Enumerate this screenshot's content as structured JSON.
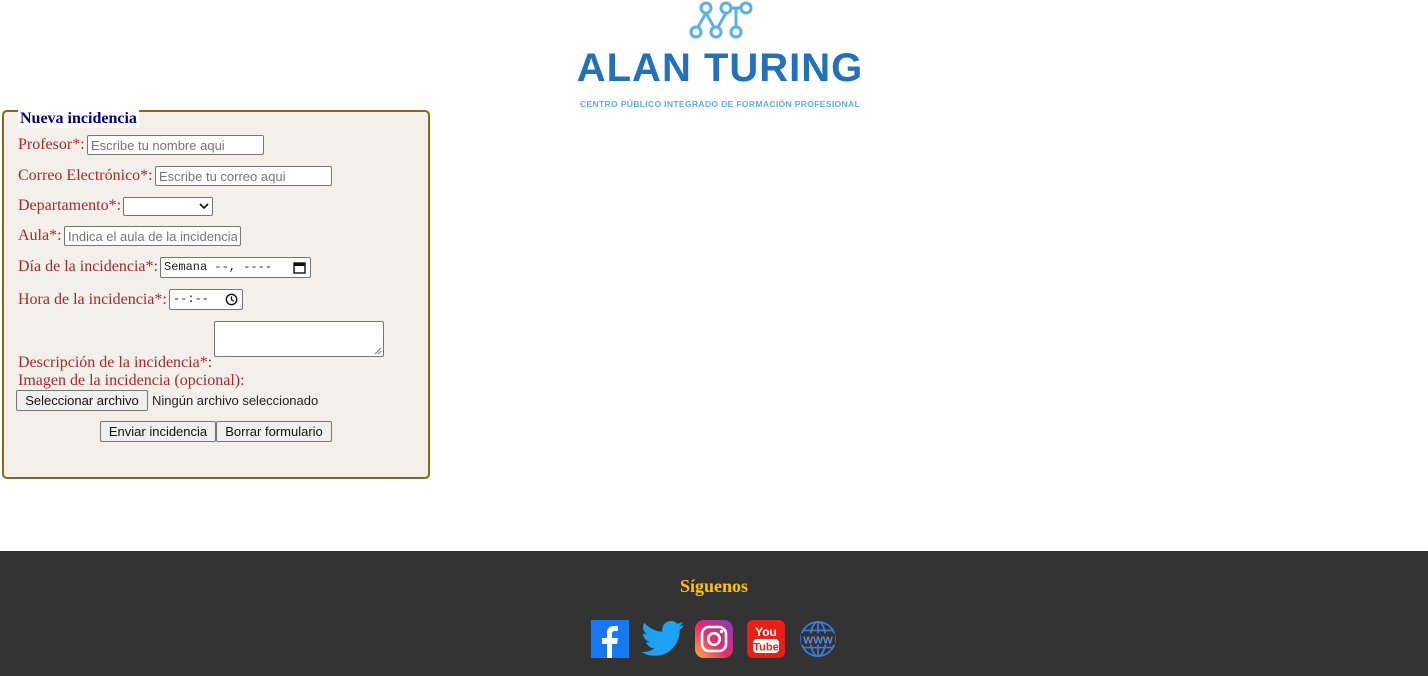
{
  "logo": {
    "name": "ALAN TURING",
    "tagline": "CENTRO PÚBLICO INTEGRADO DE FORMACIÓN PROFESIONAL",
    "brand_color": "#2471b8",
    "accent_color": "#5ab0e4"
  },
  "form": {
    "legend": "Nueva incidencia",
    "profesor": {
      "label": "Profesor*:",
      "placeholder": "Escribe tu nombre aqui",
      "value": ""
    },
    "correo": {
      "label": "Correo Electrónico*:",
      "placeholder": "Escribe tu correo aqui",
      "value": ""
    },
    "departamento": {
      "label": "Departamento*:",
      "selected": ""
    },
    "aula": {
      "label": "Aula*:",
      "placeholder": "Indica el aula de la incidencia",
      "value": ""
    },
    "dia": {
      "label": "Día de la incidencia*:",
      "value": "Semana --, ----"
    },
    "hora": {
      "label": "Hora de la incidencia*:",
      "value": "--:--"
    },
    "descripcion": {
      "label": "Descripción de la incidencia*:",
      "value": ""
    },
    "imagen": {
      "label": "Imagen de la incidencia (opcional):",
      "button": "Seleccionar archivo",
      "status": "Ningún archivo seleccionado"
    },
    "submit_label": "Enviar incidencia",
    "reset_label": "Borrar formulario"
  },
  "footer": {
    "title": "Síguenos",
    "social": [
      {
        "icon": "facebook-icon",
        "color": "#1877f2"
      },
      {
        "icon": "twitter-icon",
        "color": "#1da1f2"
      },
      {
        "icon": "instagram-icon",
        "color": "#e1306c"
      },
      {
        "icon": "youtube-icon",
        "color": "#e62117"
      },
      {
        "icon": "website-icon",
        "color": "#3b7ddd"
      }
    ]
  }
}
